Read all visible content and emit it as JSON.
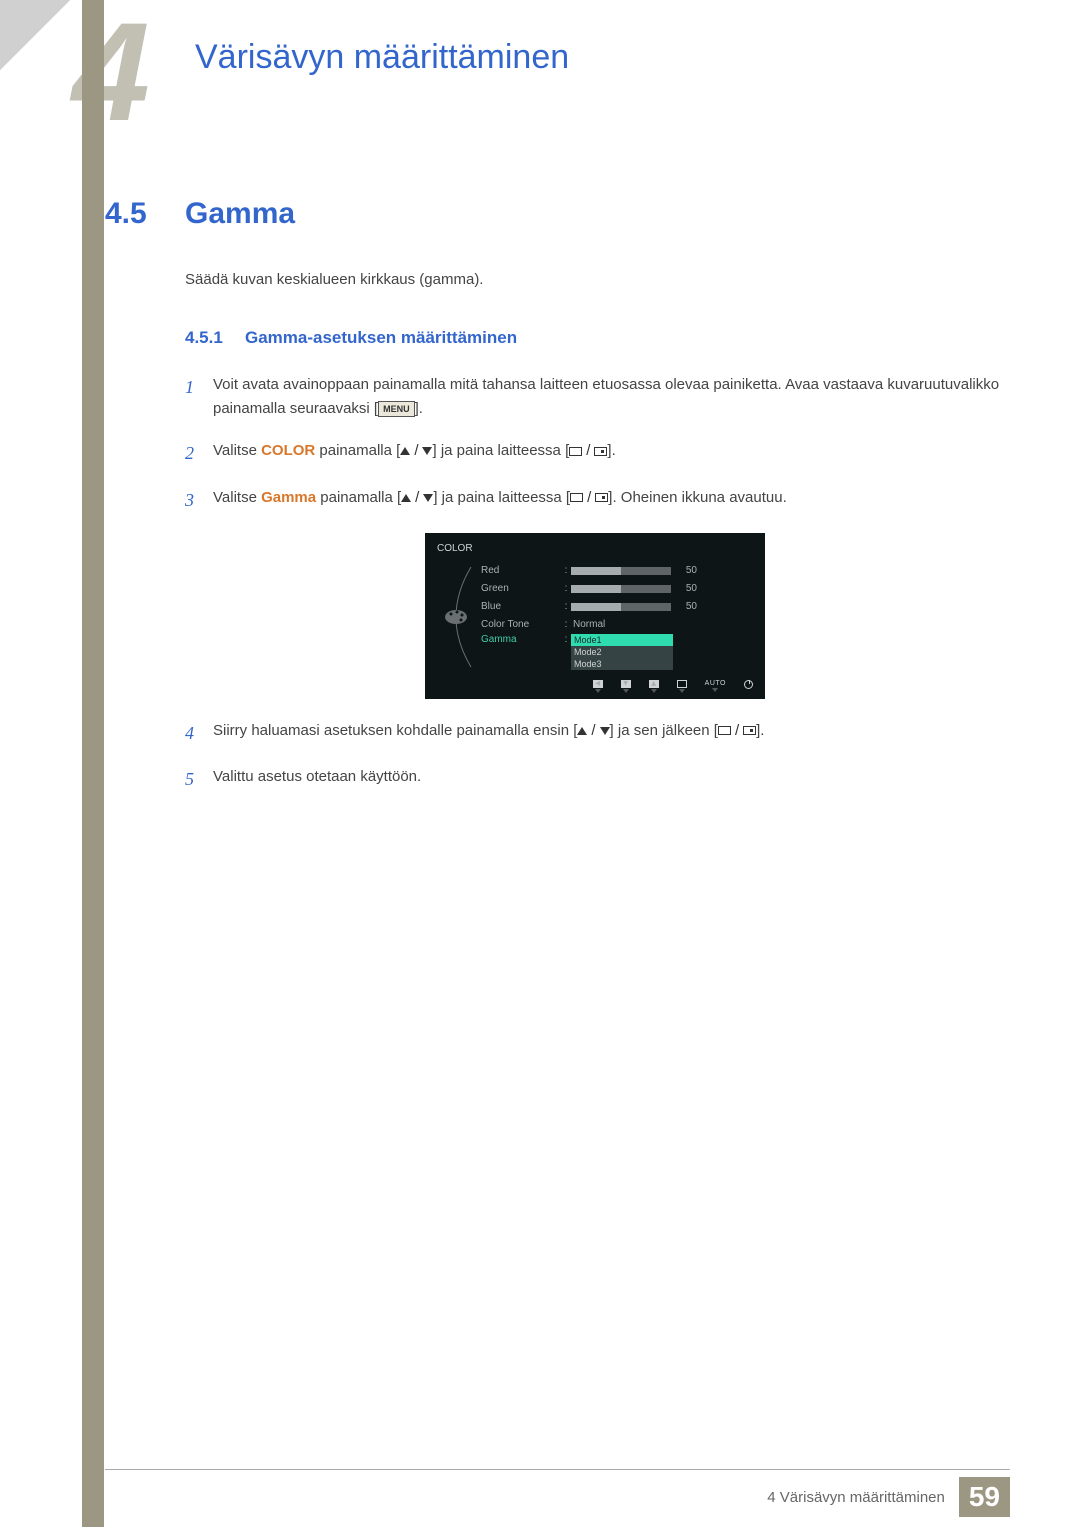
{
  "chapter_number_bg": "4",
  "page_title": "Värisävyn määrittäminen",
  "section": {
    "number": "4.5",
    "title": "Gamma",
    "description": "Säädä kuvan keskialueen kirkkaus (gamma)."
  },
  "subsection": {
    "number": "4.5.1",
    "title": "Gamma-asetuksen määrittäminen"
  },
  "steps": {
    "s1": {
      "num": "1",
      "text_a": "Voit avata avainoppaan painamalla mitä tahansa laitteen etuosassa olevaa painiketta. Avaa vastaava kuvaruutuvalikko painamalla seuraavaksi [",
      "menu": "MENU",
      "text_b": "]."
    },
    "s2": {
      "num": "2",
      "text_a": "Valitse ",
      "kw": "COLOR",
      "text_b": " painamalla [",
      "text_c": "] ja paina laitteessa [",
      "text_d": "]."
    },
    "s3": {
      "num": "3",
      "text_a": "Valitse ",
      "kw": "Gamma",
      "text_b": " painamalla [",
      "text_c": "] ja paina laitteessa [",
      "text_d": "]. Oheinen ikkuna avautuu."
    },
    "s4": {
      "num": "4",
      "text_a": "Siirry haluamasi asetuksen kohdalle painamalla ensin [",
      "text_b": "] ja sen jälkeen [",
      "text_c": "]."
    },
    "s5": {
      "num": "5",
      "text": "Valittu asetus otetaan käyttöön."
    }
  },
  "osd": {
    "title": "COLOR",
    "rows": {
      "red": {
        "label": "Red",
        "value": "50",
        "pct": 50
      },
      "green": {
        "label": "Green",
        "value": "50",
        "pct": 50
      },
      "blue": {
        "label": "Blue",
        "value": "50",
        "pct": 50
      },
      "colortone": {
        "label": "Color Tone",
        "value": "Normal"
      },
      "gamma": {
        "label": "Gamma",
        "modes": [
          "Mode1",
          "Mode2",
          "Mode3"
        ],
        "selected": "Mode1"
      }
    },
    "footer_auto": "AUTO"
  },
  "footer": {
    "text": "4 Värisävyn määrittäminen",
    "page": "59"
  }
}
